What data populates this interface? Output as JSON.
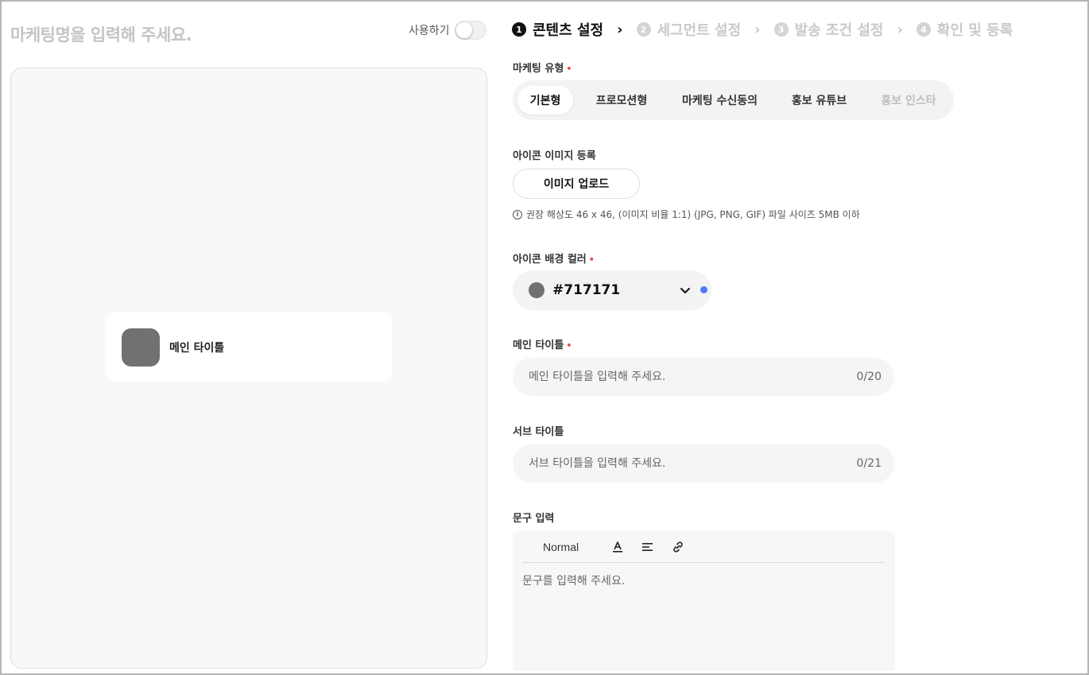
{
  "left": {
    "marketing_name_placeholder": "마케팅명을 입력해 주세요.",
    "use_label": "사용하기",
    "use_toggle_on": false,
    "preview": {
      "card_title": "메인 타이틀",
      "icon_color": "#717171"
    }
  },
  "stepper": {
    "steps": [
      {
        "num": "1",
        "label": "콘텐츠 설정"
      },
      {
        "num": "2",
        "label": "세그먼트 설정"
      },
      {
        "num": "3",
        "label": "발송 조건 설정"
      },
      {
        "num": "4",
        "label": "확인 및 등록"
      }
    ],
    "active_step": 1
  },
  "form": {
    "marketing_type": {
      "label": "마케팅 유형",
      "required_mark": "•",
      "options": [
        "기본형",
        "프로모션형",
        "마케팅 수신동의",
        "홍보 유튜브",
        "홍보 인스타"
      ],
      "selected": "기본형"
    },
    "icon_image": {
      "label": "아이콘 이미지 등록",
      "upload_button": "이미지 업로드",
      "info_glyph": "i",
      "hint": "권장 해상도 46 x 46, (이미지 비율 1:1) (JPG, PNG, GIF) 파일 사이즈 5MB 이하"
    },
    "icon_bg_color": {
      "label": "아이콘 배경 컬러",
      "required_mark": "•",
      "value": "#717171",
      "indicator_color": "#4a7cf5"
    },
    "main_title": {
      "label": "메인 타이틀",
      "required_mark": "•",
      "placeholder": "메인 타이틀을 입력해 주세요.",
      "counter": "0/20"
    },
    "sub_title": {
      "label": "서브 타이틀",
      "placeholder": "서브 타이틀을 입력해 주세요.",
      "counter": "0/21"
    },
    "phrase": {
      "label": "문구 입력",
      "toolbar_format": "Normal",
      "placeholder": "문구를 입력해 주세요."
    }
  }
}
